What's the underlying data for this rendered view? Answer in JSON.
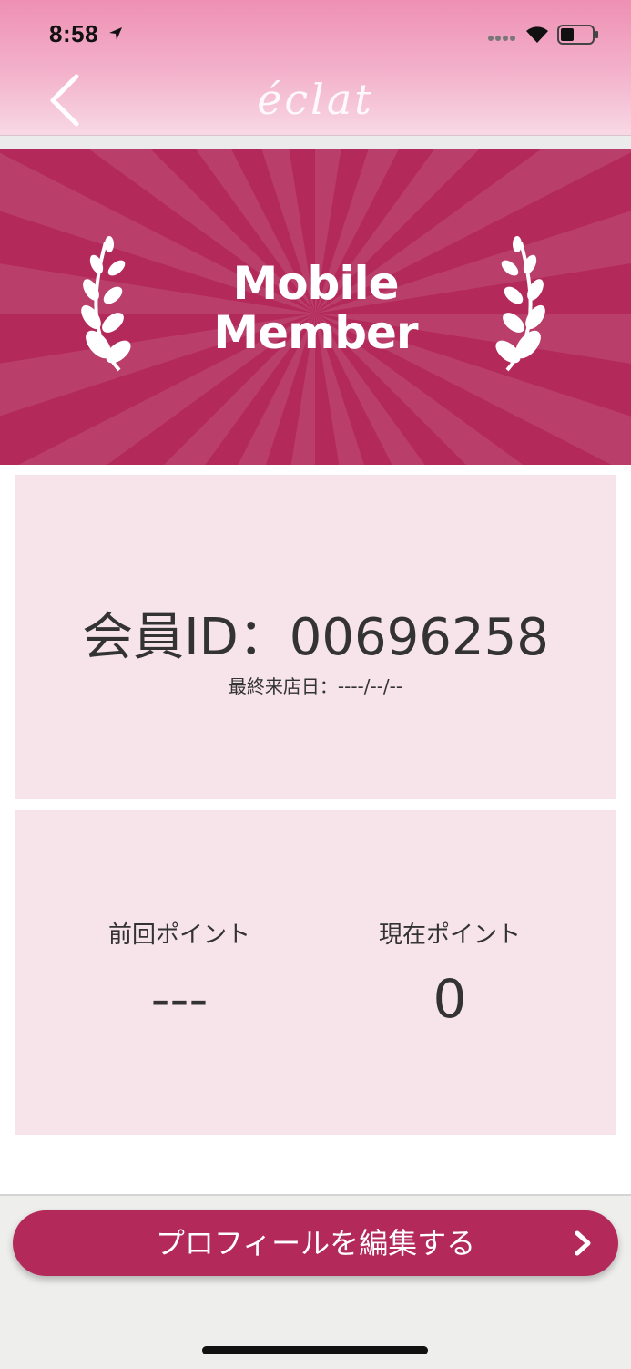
{
  "status_bar": {
    "time": "8:58",
    "icons": [
      "location-arrow-icon",
      "signal-icon",
      "wifi-icon",
      "battery-icon"
    ]
  },
  "header": {
    "title": "éclat",
    "back_icon": "chevron-left-icon"
  },
  "banner": {
    "line1": "Mobile",
    "line2": "Member",
    "icons": [
      "laurel-left-icon",
      "laurel-right-icon"
    ]
  },
  "member": {
    "id_text": "会員ID：00696258",
    "last_visit": "最終来店日：----/--/--"
  },
  "points": {
    "previous_label": "前回ポイント",
    "previous_value": "---",
    "current_label": "現在ポイント",
    "current_value": "0"
  },
  "actions": {
    "edit_profile_label": "プロフィールを編集する",
    "edit_icon": "chevron-right-icon"
  },
  "colors": {
    "accent": "#b3295a",
    "card_bg": "#f7e4eb",
    "header_top": "#ee90b3"
  }
}
